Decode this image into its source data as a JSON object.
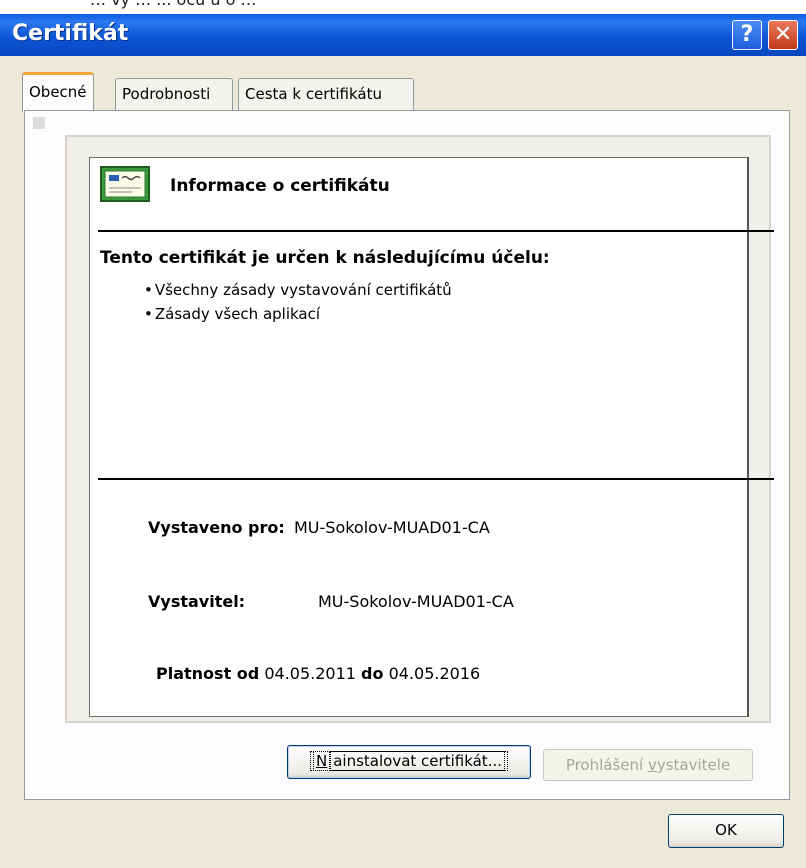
{
  "caption_fragment": "… vy … ... ocu u o … ",
  "window": {
    "title": "Certifikát",
    "help_glyph": "?",
    "close_glyph": "✕"
  },
  "tabs": [
    {
      "label": "Obecné",
      "active": true
    },
    {
      "label": "Podrobnosti",
      "active": false
    },
    {
      "label": "Cesta k certifikátu",
      "active": false
    }
  ],
  "info": {
    "icon": "certificate-icon",
    "heading": "Informace o certifikátu",
    "purpose_title": "Tento certifikát je určen k následujícímu účelu:",
    "purposes": [
      "Všechny zásady vystavování certifikátů",
      "Zásady všech aplikací"
    ],
    "issued_to_label": "Vystaveno pro:",
    "issued_to_value": "MU-Sokolov-MUAD01-CA",
    "issuer_label": "Vystavitel:",
    "issuer_value": "MU-Sokolov-MUAD01-CA",
    "valid_from_label": "Platnost od",
    "valid_from_value": "04.05.2011",
    "valid_to_label": "do",
    "valid_to_value": "04.05.2016"
  },
  "buttons": {
    "install_prefix": "N",
    "install_rest": "ainstalovat certifikát...",
    "statement_prefix": "Prohlášení ",
    "statement_accel": "v",
    "statement_rest": "ystavitele",
    "ok": "OK"
  },
  "colors": {
    "titlebar": "#0a5be0",
    "dialog_bg": "#ece9d8",
    "active_tab_accent": "#f0a43c"
  }
}
